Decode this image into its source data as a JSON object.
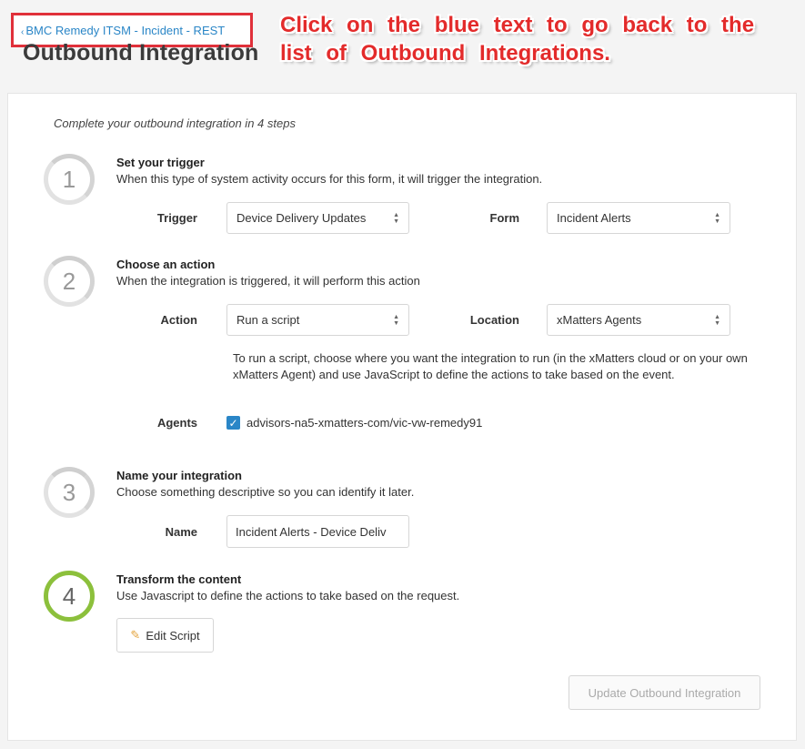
{
  "breadcrumb": {
    "label": "BMC Remedy ITSM - Incident - REST",
    "chevron": "‹"
  },
  "page_title": "Outbound Integration",
  "annotation": {
    "line1": "Click on the blue text to go back to the",
    "line2": "list of Outbound Integrations.",
    "color": "#e32b2b"
  },
  "intro": "Complete your outbound integration in 4 steps",
  "steps": [
    {
      "number": "1",
      "title": "Set your trigger",
      "description": "When this type of system activity occurs for this form, it will trigger the integration.",
      "fields": {
        "trigger_label": "Trigger",
        "trigger_value": "Device Delivery Updates",
        "form_label": "Form",
        "form_value": "Incident Alerts"
      }
    },
    {
      "number": "2",
      "title": "Choose an action",
      "description": "When the integration is triggered, it will perform this action",
      "fields": {
        "action_label": "Action",
        "action_value": "Run a script",
        "location_label": "Location",
        "location_value": "xMatters Agents",
        "help": "To run a script, choose where you want the integration to run (in the xMatters cloud or on your own xMatters Agent) and use JavaScript to define the actions to take based on the event.",
        "agents_label": "Agents",
        "agent_name": "advisors-na5-xmatters-com/vic-vw-remedy91",
        "agent_checked": true
      }
    },
    {
      "number": "3",
      "title": "Name your integration",
      "description": "Choose something descriptive so you can identify it later.",
      "fields": {
        "name_label": "Name",
        "name_value": "Incident Alerts - Device Deliv"
      }
    },
    {
      "number": "4",
      "title": "Transform the content",
      "description": "Use Javascript to define the actions to take based on the request.",
      "edit_script_label": "Edit Script"
    }
  ],
  "update_button_label": "Update Outbound Integration",
  "colors": {
    "link": "#2a86c7",
    "active_step": "#8cc03c",
    "highlight_box": "#e0303a"
  },
  "icons": {
    "select_arrows": "updown-arrows-icon",
    "edit": "pencil-icon",
    "check": "checkmark-icon"
  }
}
